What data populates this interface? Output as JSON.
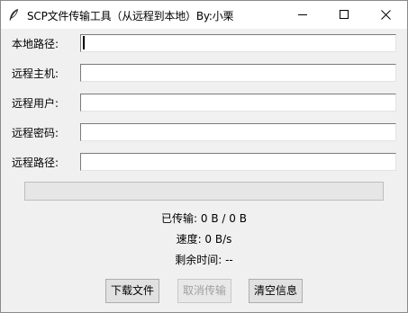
{
  "window": {
    "title": "SCP文件传输工具（从远程到本地）By:小栗",
    "icon": "feather-icon"
  },
  "form": {
    "fields": [
      {
        "label": "本地路径:",
        "value": ""
      },
      {
        "label": "远程主机:",
        "value": ""
      },
      {
        "label": "远程用户:",
        "value": ""
      },
      {
        "label": "远程密码:",
        "value": ""
      },
      {
        "label": "远程路径:",
        "value": ""
      }
    ]
  },
  "progress": {
    "fraction": 0.0
  },
  "status": {
    "transferred": "已传输: 0 B / 0 B",
    "speed": "速度: 0 B/s",
    "remaining": "剩余时间: --"
  },
  "buttons": {
    "download": "下载文件",
    "cancel": "取消传输",
    "clear": "清空信息"
  },
  "colors": {
    "window_bg": "#f0f0f0",
    "titlebar_bg": "#ffffff",
    "progress_fill": "#06b025",
    "disabled_text": "#a0a0a0"
  }
}
